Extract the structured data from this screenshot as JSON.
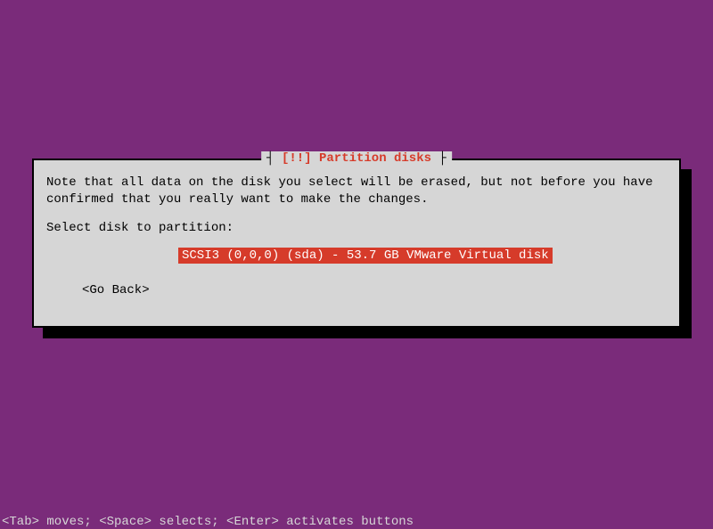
{
  "dialog": {
    "title_prefix": "[!!]",
    "title_text": "Partition disks",
    "instruction": "Note that all data on the disk you select will be erased, but not before you have confirmed that you really want to make the changes.",
    "prompt": "Select disk to partition:",
    "disk_option": "SCSI3 (0,0,0) (sda) - 53.7 GB VMware Virtual disk",
    "go_back": "<Go Back>"
  },
  "footer": {
    "hint": "<Tab> moves; <Space> selects; <Enter> activates buttons"
  }
}
